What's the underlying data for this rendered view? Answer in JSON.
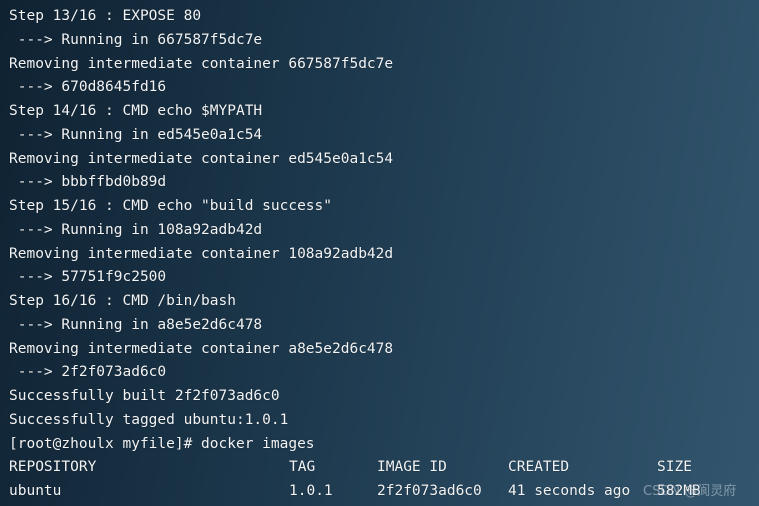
{
  "lines": [
    "Step 13/16 : EXPOSE 80",
    " ---> Running in 667587f5dc7e",
    "Removing intermediate container 667587f5dc7e",
    " ---> 670d8645fd16",
    "Step 14/16 : CMD echo $MYPATH",
    " ---> Running in ed545e0a1c54",
    "Removing intermediate container ed545e0a1c54",
    " ---> bbbffbd0b89d",
    "Step 15/16 : CMD echo \"build success\"",
    " ---> Running in 108a92adb42d",
    "Removing intermediate container 108a92adb42d",
    " ---> 57751f9c2500",
    "Step 16/16 : CMD /bin/bash",
    " ---> Running in a8e5e2d6c478",
    "Removing intermediate container a8e5e2d6c478",
    " ---> 2f2f073ad6c0",
    "Successfully built 2f2f073ad6c0",
    "Successfully tagged ubuntu:1.0.1",
    "[root@zhoulx myfile]# docker images"
  ],
  "table": {
    "headers": [
      "REPOSITORY",
      "TAG",
      "IMAGE ID",
      "CREATED",
      "SIZE"
    ],
    "rows": [
      [
        "ubuntu",
        "1.0.1",
        "2f2f073ad6c0",
        "41 seconds ago",
        "582MB"
      ]
    ]
  },
  "watermark": "CSDN @阆灵府"
}
